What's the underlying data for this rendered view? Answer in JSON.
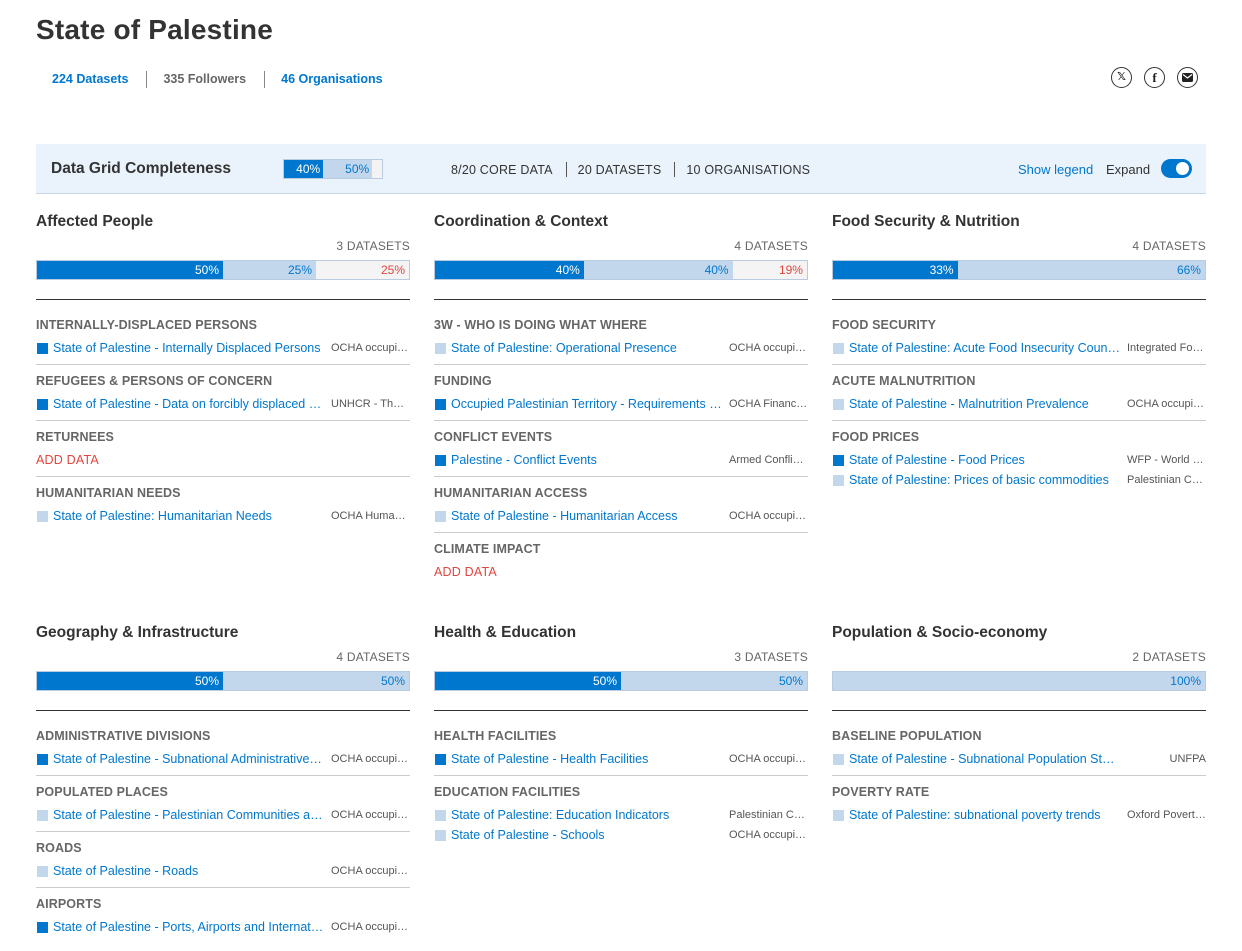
{
  "page": {
    "title": "State of Palestine"
  },
  "stats": {
    "datasets": "224 Datasets",
    "followers": "335 Followers",
    "organisations": "46 Organisations"
  },
  "share": {
    "x_label": "𝕏",
    "facebook_label": "f"
  },
  "data_grid": {
    "title": "Data Grid Completeness",
    "mini_bar": {
      "core": "40%",
      "other": "50%",
      "core_fraction": 0.4,
      "other_fraction": 0.5
    },
    "core_data": "8/20 CORE DATA",
    "datasets": "20 DATASETS",
    "organisations": "10 ORGANISATIONS",
    "show_legend": "Show legend",
    "expand": "Expand",
    "expand_on": true
  },
  "colors": {
    "core": "#0077ce",
    "other": "#c3d7ec",
    "missing": "#e0463d"
  },
  "add_data_label": "ADD DATA",
  "categories": [
    {
      "title": "Affected People",
      "count": "3 DATASETS",
      "bar": [
        {
          "kind": "core",
          "value": 50,
          "label": "50%"
        },
        {
          "kind": "other",
          "value": 25,
          "label": "25%"
        },
        {
          "kind": "missing",
          "value": 25,
          "label": "25%"
        }
      ],
      "subcategories": [
        {
          "title": "INTERNALLY-DISPLACED PERSONS",
          "datasets": [
            {
              "name": "State of Palestine - Internally Displaced Persons",
              "org": "OCHA occupied Palestinian territory",
              "kind": "core"
            }
          ]
        },
        {
          "title": "REFUGEES & PERSONS OF CONCERN",
          "datasets": [
            {
              "name": "State of Palestine - Data on forcibly displaced populations",
              "org": "UNHCR - The UN Refugee Agency",
              "kind": "core"
            }
          ]
        },
        {
          "title": "RETURNEES",
          "datasets": []
        },
        {
          "title": "HUMANITARIAN NEEDS",
          "datasets": [
            {
              "name": "State of Palestine: Humanitarian Needs",
              "org": "OCHA Humanitarian Programme Cycle",
              "kind": "other"
            }
          ]
        }
      ]
    },
    {
      "title": "Coordination & Context",
      "count": "4 DATASETS",
      "bar": [
        {
          "kind": "core",
          "value": 40,
          "label": "40%"
        },
        {
          "kind": "other",
          "value": 40,
          "label": "40%"
        },
        {
          "kind": "missing",
          "value": 20,
          "label": "19%"
        }
      ],
      "subcategories": [
        {
          "title": "3W - WHO IS DOING WHAT WHERE",
          "datasets": [
            {
              "name": "State of Palestine: Operational Presence",
              "org": "OCHA occupied Palestinian territory",
              "kind": "other"
            }
          ]
        },
        {
          "title": "FUNDING",
          "datasets": [
            {
              "name": "Occupied Palestinian Territory - Requirements and Funding Data",
              "org": "OCHA Financial Tracking Service",
              "kind": "core"
            }
          ]
        },
        {
          "title": "CONFLICT EVENTS",
          "datasets": [
            {
              "name": "Palestine - Conflict Events",
              "org": "Armed Conflict Location & Event Data",
              "kind": "core"
            }
          ]
        },
        {
          "title": "HUMANITARIAN ACCESS",
          "datasets": [
            {
              "name": "State of Palestine - Humanitarian Access",
              "org": "OCHA occupied Palestinian territory",
              "kind": "other"
            }
          ]
        },
        {
          "title": "CLIMATE IMPACT",
          "datasets": []
        }
      ]
    },
    {
      "title": "Food Security & Nutrition",
      "count": "4 DATASETS",
      "bar": [
        {
          "kind": "core",
          "value": 33.5,
          "label": "33%"
        },
        {
          "kind": "other",
          "value": 66.5,
          "label": "66%"
        }
      ],
      "subcategories": [
        {
          "title": "FOOD SECURITY",
          "datasets": [
            {
              "name": "State of Palestine: Acute Food Insecurity Country Data",
              "org": "Integrated Food Security Phase Classification",
              "kind": "other"
            }
          ]
        },
        {
          "title": "ACUTE MALNUTRITION",
          "datasets": [
            {
              "name": "State of Palestine - Malnutrition Prevalence",
              "org": "OCHA occupied Palestinian territory",
              "kind": "other"
            }
          ]
        },
        {
          "title": "FOOD PRICES",
          "datasets": [
            {
              "name": "State of Palestine - Food Prices",
              "org": "WFP - World Food Programme",
              "kind": "core"
            },
            {
              "name": "State of Palestine: Prices of basic commodities",
              "org": "Palestinian Central Bureau of Statistics",
              "kind": "other"
            }
          ]
        }
      ]
    },
    {
      "title": "Geography & Infrastructure",
      "count": "4 DATASETS",
      "bar": [
        {
          "kind": "core",
          "value": 50,
          "label": "50%"
        },
        {
          "kind": "other",
          "value": 50,
          "label": "50%"
        }
      ],
      "subcategories": [
        {
          "title": "ADMINISTRATIVE DIVISIONS",
          "datasets": [
            {
              "name": "State of Palestine - Subnational Administrative Boundaries",
              "org": "OCHA occupied Palestinian territory",
              "kind": "core"
            }
          ]
        },
        {
          "title": "POPULATED PLACES",
          "datasets": [
            {
              "name": "State of Palestine - Palestinian Communities and Localities",
              "org": "OCHA occupied Palestinian territory",
              "kind": "other"
            }
          ]
        },
        {
          "title": "ROADS",
          "datasets": [
            {
              "name": "State of Palestine - Roads",
              "org": "OCHA occupied Palestinian territory",
              "kind": "other"
            }
          ]
        },
        {
          "title": "AIRPORTS",
          "datasets": [
            {
              "name": "State of Palestine - Ports, Airports and International Borders",
              "org": "OCHA occupied Palestinian territory",
              "kind": "core"
            }
          ]
        }
      ]
    },
    {
      "title": "Health & Education",
      "count": "3 DATASETS",
      "bar": [
        {
          "kind": "core",
          "value": 50,
          "label": "50%"
        },
        {
          "kind": "other",
          "value": 50,
          "label": "50%"
        }
      ],
      "subcategories": [
        {
          "title": "HEALTH FACILITIES",
          "datasets": [
            {
              "name": "State of Palestine - Health Facilities",
              "org": "OCHA occupied Palestinian territory",
              "kind": "core"
            }
          ]
        },
        {
          "title": "EDUCATION FACILITIES",
          "datasets": [
            {
              "name": "State of Palestine: Education Indicators",
              "org": "Palestinian Central Bureau of Statistics",
              "kind": "other"
            },
            {
              "name": "State of Palestine - Schools",
              "org": "OCHA occupied Palestinian territory",
              "kind": "other"
            }
          ]
        }
      ]
    },
    {
      "title": "Population & Socio-economy",
      "count": "2 DATASETS",
      "bar": [
        {
          "kind": "other",
          "value": 100,
          "label": "100%"
        }
      ],
      "subcategories": [
        {
          "title": "BASELINE POPULATION",
          "datasets": [
            {
              "name": "State of Palestine - Subnational Population Statistics",
              "org": "UNFPA",
              "kind": "other"
            }
          ]
        },
        {
          "title": "POVERTY RATE",
          "datasets": [
            {
              "name": "State of Palestine: subnational poverty trends",
              "org": "Oxford Poverty and Human Development Initiative",
              "kind": "other"
            }
          ]
        }
      ]
    }
  ]
}
